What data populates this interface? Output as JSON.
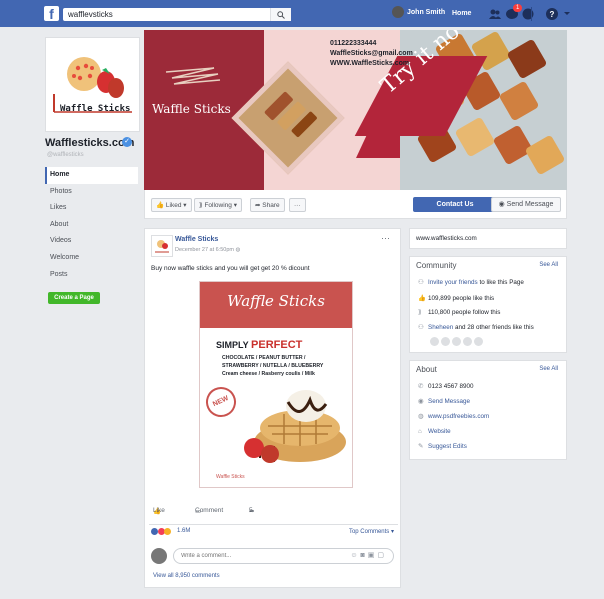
{
  "topbar": {
    "search_value": "wafflevsticks",
    "user_name": "John Smith",
    "home_label": "Home",
    "notification_count": "1"
  },
  "page": {
    "name": "Wafflesticks.com",
    "handle": "@wafflesticks",
    "logo_text": "Waffle Sticks",
    "nav": [
      "Home",
      "Photos",
      "Likes",
      "About",
      "Videos",
      "Welcome",
      "Posts"
    ],
    "create_page_label": "Create a Page"
  },
  "cover": {
    "brand": "Waffle Sticks",
    "phone": "011222333444",
    "email": "WaffleSticks@gmail.com",
    "website": "WWW.WaffleSticks.com",
    "slogan": "Try it now"
  },
  "actions": {
    "liked": "Liked",
    "following": "Following",
    "share": "Share",
    "more": "···",
    "contact": "Contact Us",
    "send_message": "Send Message"
  },
  "post": {
    "author": "Waffle Sticks",
    "date": "December 27 at 6:50pm",
    "text": "Buy now waffle sticks and you will get get 20 % dicount",
    "poster_title": "Waffle Sticks",
    "poster_simply": "SIMPLY",
    "poster_perfect": "PERFECT",
    "poster_line1": "CHOCOLATE / PEANUT BUTTER /",
    "poster_line2": "STRAWBERRY / NUTELLA / BLUEBERRY",
    "poster_line3": "Cream cheese / Rasberry coulis / Milk",
    "poster_new": "NEW",
    "poster_footer": "Waffle Sticks",
    "like_label": "Like",
    "comment_label": "Comment",
    "share_count": "5",
    "reaction_count": "1.6M",
    "top_comments": "Top Comments",
    "comment_placeholder": "Write a comment...",
    "view_all": "View all 8,950 comments"
  },
  "sidebar": {
    "website": "www.wafflesticks.com",
    "community_title": "Community",
    "see_all": "See All",
    "community": [
      {
        "icon": "invite-icon",
        "link": "Invite your friends",
        "text": " to like this Page"
      },
      {
        "icon": "like-icon",
        "link": "",
        "text": "109,899 people like this"
      },
      {
        "icon": "follow-icon",
        "link": "",
        "text": "110,800 people follow this"
      },
      {
        "icon": "friends-icon",
        "link": "Sheheen",
        "text": " and 28 other friends like this"
      }
    ],
    "about_title": "About",
    "about": [
      {
        "icon": "phone-icon",
        "text": "0123 4567 8900",
        "is_link": false
      },
      {
        "icon": "message-icon",
        "text": "Send Message",
        "is_link": true
      },
      {
        "icon": "globe-icon",
        "text": "www.psdfreebies.com",
        "is_link": true
      },
      {
        "icon": "website-icon",
        "text": "Website",
        "is_link": true
      },
      {
        "icon": "pencil-icon",
        "text": "Suggest Edits",
        "is_link": true
      }
    ]
  },
  "colors": {
    "facebook_blue": "#4267b2",
    "brand_red": "#b3253a",
    "link": "#385898",
    "create_green": "#42b72a"
  }
}
